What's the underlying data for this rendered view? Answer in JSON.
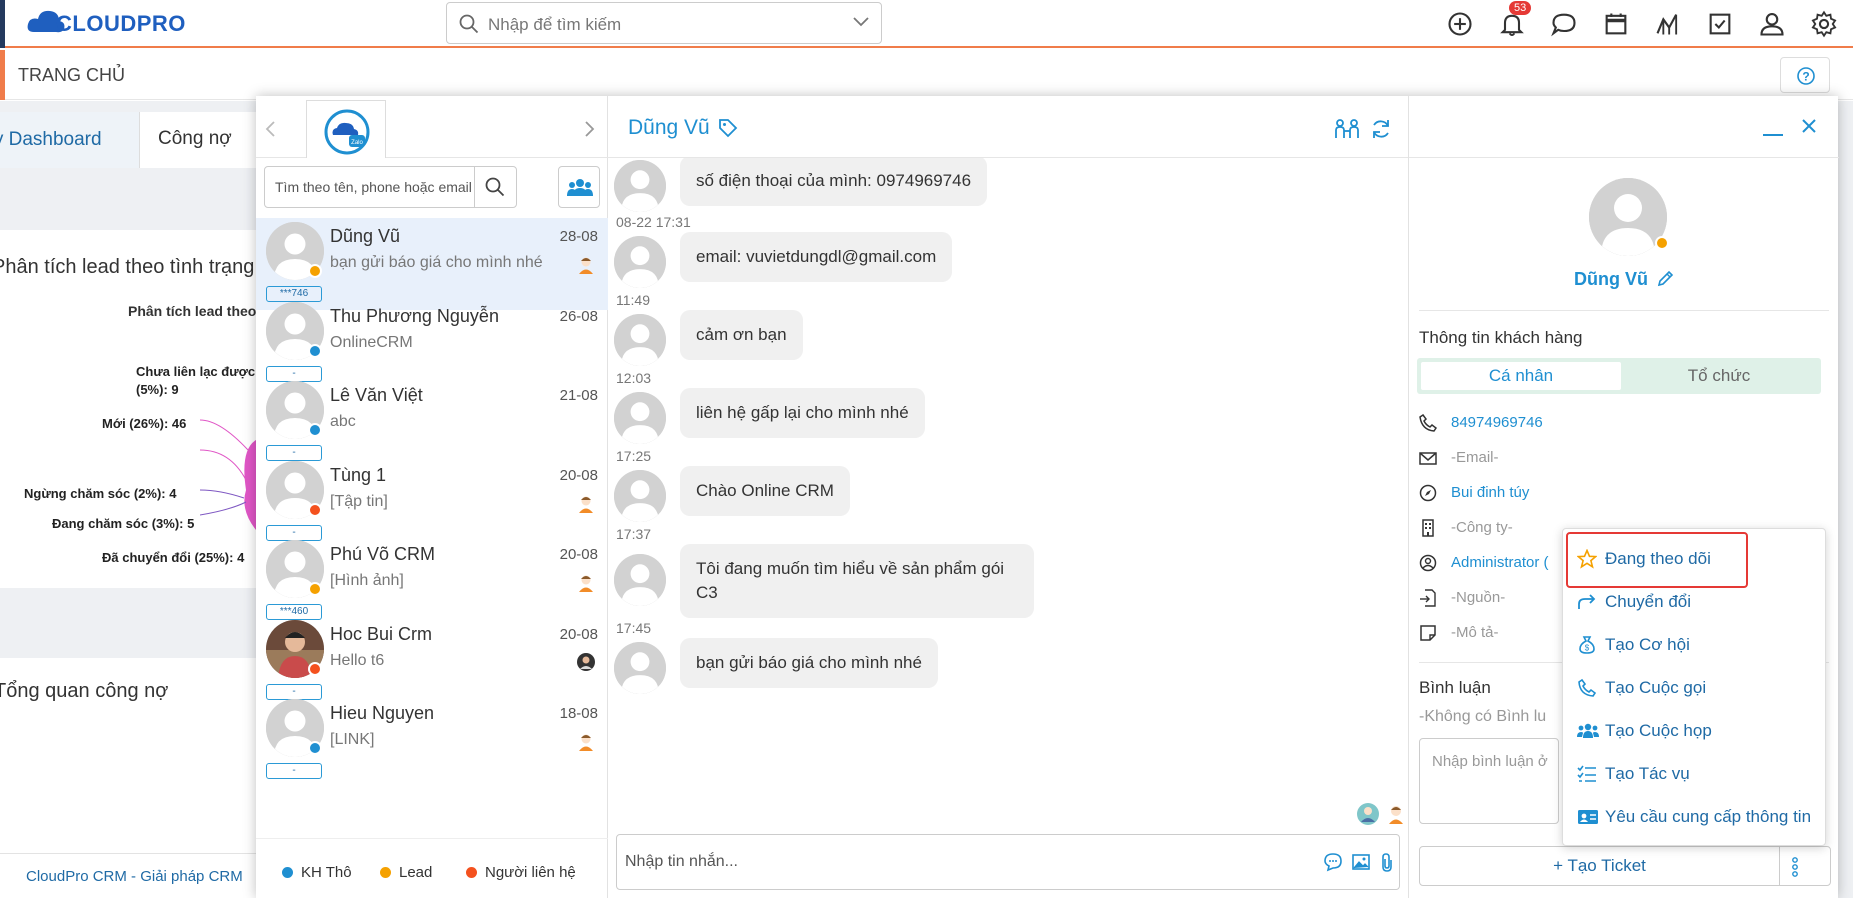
{
  "app": {
    "brand": "CLOUDPRO",
    "search_placeholder": "Nhập để tìm kiếm",
    "notification_count": "53",
    "icons": [
      "add-icon",
      "bell-icon",
      "chat-icon",
      "calendar-icon",
      "chart-icon",
      "checkbox-icon",
      "user-icon",
      "gear-icon"
    ]
  },
  "page": {
    "title": "TRANG CHỦ"
  },
  "dashboard": {
    "tabs": [
      "My Dashboard",
      "Công nợ"
    ],
    "lead_card_title": "Phân tích lead theo tình trạng",
    "lead_chart_subtitle": "Phân tích lead theo",
    "lead_labels": [
      "Chưa liên lạc được",
      "(5%): 9",
      "Mới (26%): 46",
      "Ngừng chăm sóc (2%): 4",
      "Đang chăm sóc (3%): 5",
      "Đã chuyển đổi (25%): 4"
    ],
    "debt_card_title": "Tổng quan công nợ",
    "footer": "CloudPro CRM - Giải pháp CRM"
  },
  "contacts": {
    "search_placeholder": "Tìm theo tên, phone hoặc email",
    "items": [
      {
        "name": "Dũng Vũ",
        "last": "bạn gửi báo giá cho mình nhé",
        "date": "28-08",
        "tag": "***746",
        "status_color": "#f5a100",
        "active": true
      },
      {
        "name": "Thu Phương Nguyễn",
        "last": "OnlineCRM",
        "date": "26-08",
        "tag": "-",
        "status_color": "#1f8fd1",
        "active": false
      },
      {
        "name": "Lê Văn Việt",
        "last": "abc",
        "date": "21-08",
        "tag": "-",
        "status_color": "#1f8fd1",
        "active": false
      },
      {
        "name": "Tùng 1",
        "last": "[Tập tin]",
        "date": "20-08",
        "tag": "-",
        "status_color": "#f4511e",
        "active": false
      },
      {
        "name": "Phú Võ CRM",
        "last": "[Hình ảnh]",
        "date": "20-08",
        "tag": "***460",
        "status_color": "#f5a100",
        "active": false
      },
      {
        "name": "Hoc Bui Crm",
        "last": "Hello t6",
        "date": "20-08",
        "tag": "-",
        "status_color": "#f4511e",
        "active": false
      },
      {
        "name": "Hieu Nguyen",
        "last": "[LINK]",
        "date": "18-08",
        "tag": "-",
        "status_color": "#1f8fd1",
        "active": false
      }
    ],
    "legend": [
      {
        "label": "KH Thô",
        "color": "#1f8fd1"
      },
      {
        "label": "Lead",
        "color": "#f5a100"
      },
      {
        "label": "Người liên hệ",
        "color": "#f4511e"
      }
    ]
  },
  "chat": {
    "contact_name": "Dũng Vũ",
    "messages": [
      {
        "time": "",
        "text": "số điện thoại của mình: 0974969746"
      },
      {
        "time": "08-22 17:31",
        "text": "email: vuvietdungdl@gmail.com"
      },
      {
        "time": "11:49",
        "text": "cảm ơn bạn"
      },
      {
        "time": "12:03",
        "text": "liên hệ gấp lại cho mình nhé"
      },
      {
        "time": "17:25",
        "text": "Chào Online CRM"
      },
      {
        "time": "17:37",
        "text": "Tôi đang muốn tìm hiểu về sản phẩm gói C3"
      },
      {
        "time": "17:45",
        "text": "bạn gửi báo giá cho mình nhé"
      }
    ],
    "composer_placeholder": "Nhập tin nhắn..."
  },
  "customer": {
    "name": "Dũng Vũ",
    "section_title": "Thông tin khách hàng",
    "tabs": [
      "Cá nhân",
      "Tổ chức"
    ],
    "fields": {
      "phone": "84974969746",
      "email": "-Email-",
      "address": "Bui đinh túy",
      "company": "-Công ty-",
      "owner": "Administrator (",
      "source": "-Nguồn-",
      "description": "-Mô tả-"
    },
    "comments_title": "Bình luận",
    "no_comments": "-Không có Bình lu",
    "comment_placeholder": "Nhập bình luận ở",
    "create_ticket": "Tạo Ticket"
  },
  "menu": {
    "items": [
      {
        "label": "Đang theo dõi",
        "icon": "star-icon"
      },
      {
        "label": "Chuyển đổi",
        "icon": "share-icon"
      },
      {
        "label": "Tạo Cơ hội",
        "icon": "money-bag-icon"
      },
      {
        "label": "Tạo Cuộc gọi",
        "icon": "phone-icon"
      },
      {
        "label": "Tạo Cuộc họp",
        "icon": "people-icon"
      },
      {
        "label": "Tạo Tác vụ",
        "icon": "tasks-icon"
      },
      {
        "label": "Yêu cầu cung cấp thông tin",
        "icon": "id-card-icon"
      }
    ]
  }
}
